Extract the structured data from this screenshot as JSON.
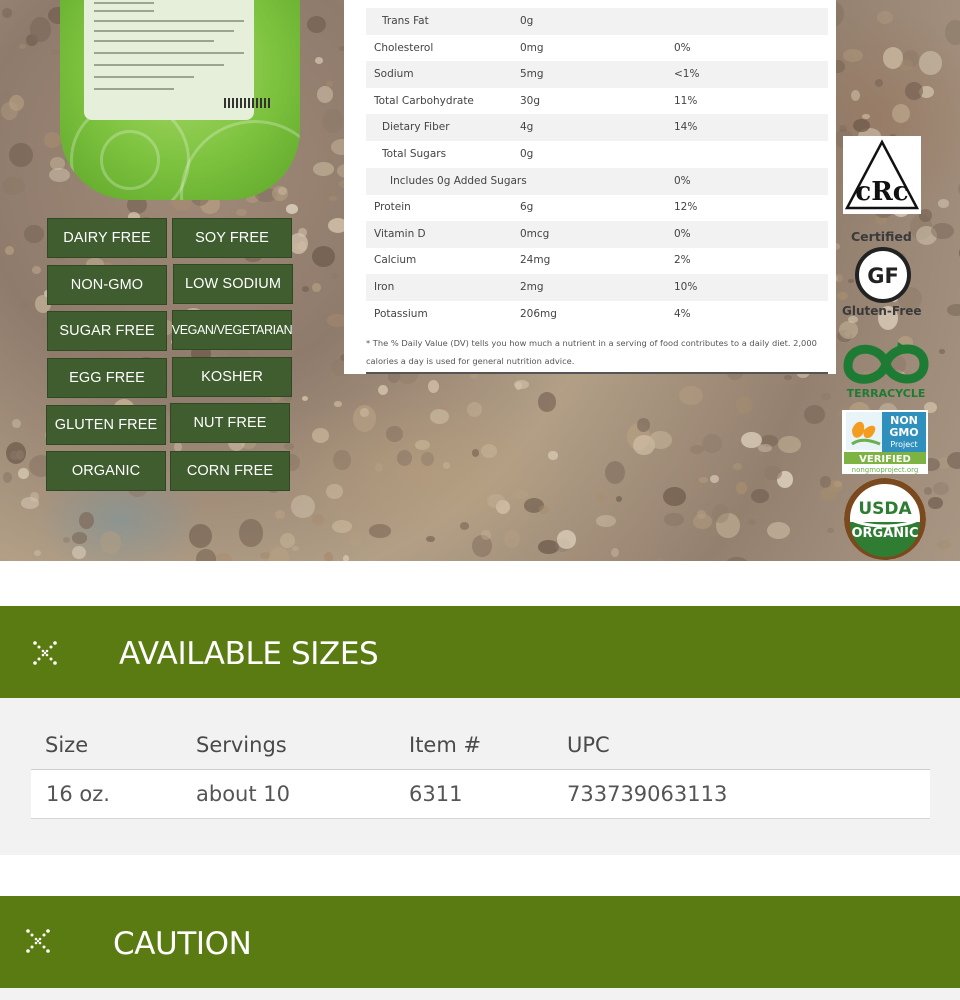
{
  "product_badges": [
    "DAIRY FREE",
    "SOY FREE",
    "NON-GMO",
    "LOW SODIUM",
    "SUGAR FREE",
    "VEGAN/VEGETARIAN",
    "EGG FREE",
    "KOSHER",
    "GLUTEN FREE",
    "NUT FREE",
    "ORGANIC",
    "CORN FREE"
  ],
  "nutrition": {
    "rows": [
      {
        "name": "Trans Fat",
        "amount": "0g",
        "dv": ""
      },
      {
        "name": "Cholesterol",
        "amount": "0mg",
        "dv": "0%"
      },
      {
        "name": "Sodium",
        "amount": "5mg",
        "dv": "<1%"
      },
      {
        "name": "Total Carbohydrate",
        "amount": "30g",
        "dv": "11%"
      },
      {
        "name": "Dietary Fiber",
        "amount": "4g",
        "dv": "14%"
      },
      {
        "name": "Total Sugars",
        "amount": "0g",
        "dv": ""
      },
      {
        "name": "Includes 0g Added Sugars",
        "amount": "",
        "dv": "0%"
      },
      {
        "name": "Protein",
        "amount": "6g",
        "dv": "12%"
      },
      {
        "name": "Vitamin D",
        "amount": "0mcg",
        "dv": "0%"
      },
      {
        "name": "Calcium",
        "amount": "24mg",
        "dv": "2%"
      },
      {
        "name": "Iron",
        "amount": "2mg",
        "dv": "10%"
      },
      {
        "name": "Potassium",
        "amount": "206mg",
        "dv": "4%"
      }
    ],
    "footnote": "* The % Daily Value (DV) tells you how much a nutrient in a serving of food contributes to a daily diet. 2,000 calories a day is used for general nutrition advice."
  },
  "certifications": {
    "kosher": "cRc",
    "gluten_free_top": "Certified",
    "gluten_free_mark": "GF",
    "gluten_free_bottom": "Gluten-Free",
    "terracycle": "TERRACYCLE",
    "non_gmo_line1": "NON",
    "non_gmo_line2": "GMO",
    "non_gmo_line3": "Project",
    "non_gmo_verified": "VERIFIED",
    "non_gmo_url": "nongmoproject.org",
    "usda_line1": "USDA",
    "usda_line2": "ORGANIC"
  },
  "available_sizes": {
    "title": "AVAILABLE SIZES",
    "headers": [
      "Size",
      "Servings",
      "Item #",
      "UPC"
    ],
    "rows": [
      [
        "16 oz.",
        "about 10",
        "6311",
        "733739063113"
      ]
    ]
  },
  "caution": {
    "title": "CAUTION"
  },
  "colors": {
    "badge_green": "#3f5d2f",
    "section_green": "#5a7b12",
    "panel_gray": "#f2f2f2"
  },
  "icons": {
    "section_toggle": "sparkle-x-icon"
  }
}
